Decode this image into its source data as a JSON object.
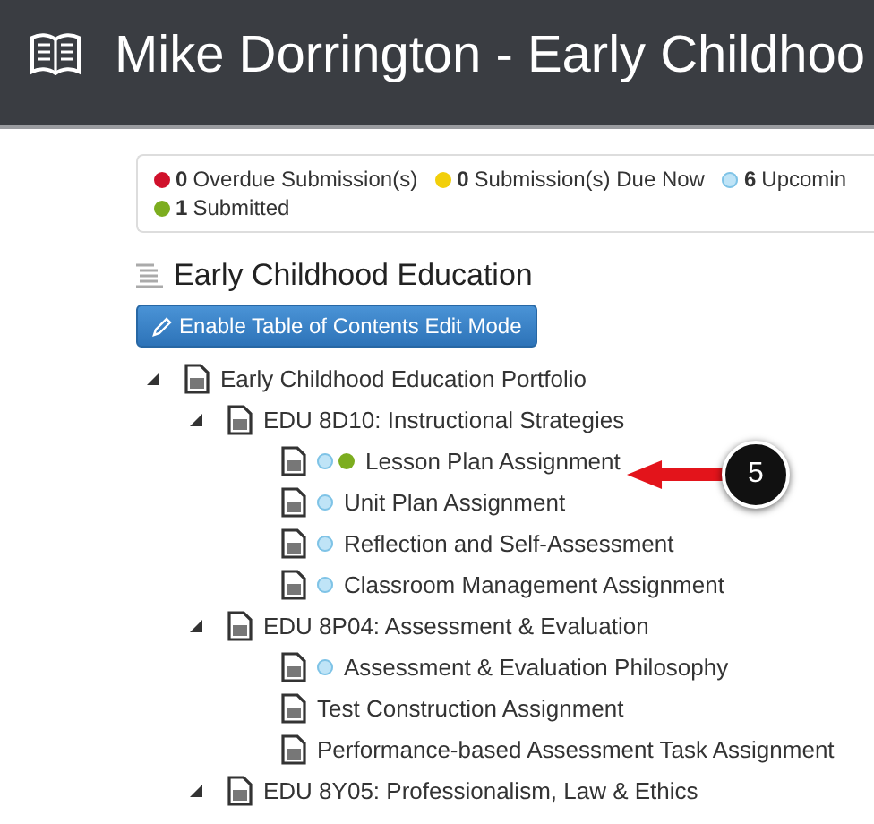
{
  "header": {
    "title": "Mike Dorrington - Early Childhoo"
  },
  "legend": [
    {
      "color": "#d0112b",
      "count": "0",
      "label": "Overdue Submission(s)"
    },
    {
      "color": "#f2cf0a",
      "count": "0",
      "label": "Submission(s) Due Now"
    },
    {
      "color": "#bfe4f7",
      "count": "6",
      "label": "Upcomin"
    },
    {
      "color": "#7cad1f",
      "count": "1",
      "label": "Submitted"
    }
  ],
  "toc": {
    "title": "Early Childhood Education",
    "edit_button": "Enable Table of Contents Edit Mode",
    "tree": [
      {
        "label": "Early Childhood Education Portfolio",
        "expanded": true,
        "children": [
          {
            "label": "EDU 8D10: Instructional Strategies",
            "expanded": true,
            "children": [
              {
                "label": "Lesson Plan Assignment",
                "dots": [
                  {
                    "color": "#bfe4f7"
                  },
                  {
                    "color": "#7cad1f"
                  }
                ]
              },
              {
                "label": "Unit Plan Assignment",
                "dots": [
                  {
                    "color": "#bfe4f7"
                  }
                ]
              },
              {
                "label": "Reflection and Self-Assessment",
                "dots": [
                  {
                    "color": "#bfe4f7"
                  }
                ]
              },
              {
                "label": "Classroom Management Assignment",
                "dots": [
                  {
                    "color": "#bfe4f7"
                  }
                ]
              }
            ]
          },
          {
            "label": "EDU 8P04: Assessment & Evaluation",
            "expanded": true,
            "children": [
              {
                "label": "Assessment & Evaluation Philosophy",
                "dots": [
                  {
                    "color": "#bfe4f7"
                  }
                ]
              },
              {
                "label": "Test Construction Assignment"
              },
              {
                "label": "Performance-based Assessment Task Assignment"
              }
            ]
          },
          {
            "label": "EDU 8Y05: Professionalism, Law & Ethics",
            "expanded": true
          }
        ]
      }
    ]
  },
  "callout": {
    "number": "5"
  }
}
